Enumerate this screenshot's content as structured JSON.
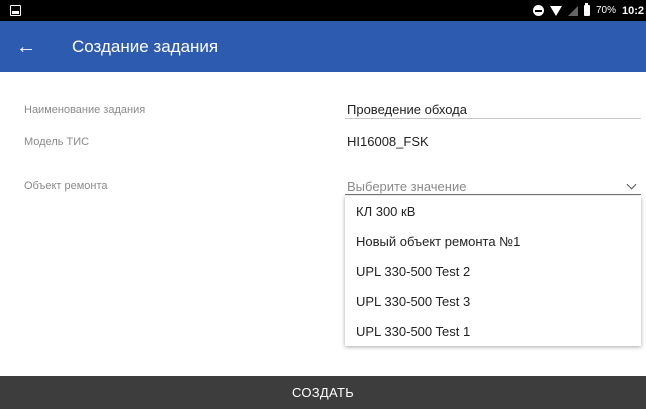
{
  "status_bar": {
    "battery_percent": "70%",
    "time": "10:2"
  },
  "app_bar": {
    "title": "Создание задания",
    "color": "#2d5bb0"
  },
  "form": {
    "task_name": {
      "label": "Наименование задания",
      "value": "Проведение обхода"
    },
    "model": {
      "label": "Модель ТИС",
      "value": "HI16008_FSK"
    },
    "repair_object": {
      "label": "Объект ремонта",
      "placeholder": "Выберите значение",
      "options": [
        "КЛ 300 кВ",
        "Новый объект ремонта №1",
        "UPL 330-500 Test 2",
        "UPL 330-500 Test 3",
        "UPL 330-500 Test 1"
      ]
    }
  },
  "actions": {
    "create_label": "СОЗДАТЬ"
  },
  "icons": {
    "back": "arrow-left-icon",
    "dropdown": "chevron-down-icon",
    "notification": "image-icon",
    "dnd": "do-not-disturb-icon",
    "wifi": "wifi-icon",
    "signal": "signal-icon",
    "battery": "battery-icon"
  }
}
